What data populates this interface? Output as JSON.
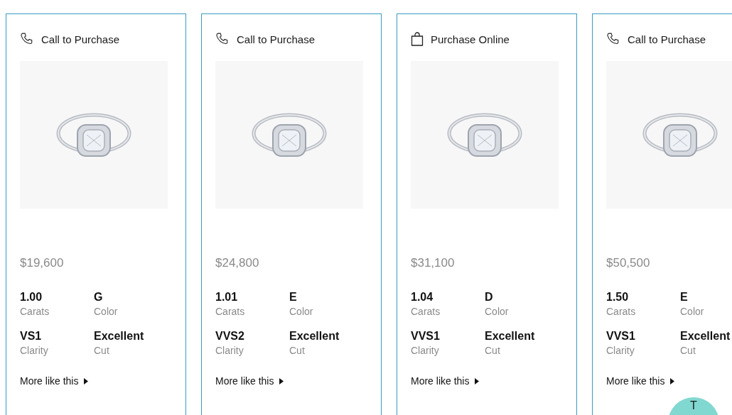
{
  "products": [
    {
      "kind": "call",
      "purchase_label": "Call to Purchase",
      "price": "$19,600",
      "specs": [
        {
          "value": "1.00",
          "label": "Carats"
        },
        {
          "value": "G",
          "label": "Color"
        },
        {
          "value": "VS1",
          "label": "Clarity"
        },
        {
          "value": "Excellent",
          "label": "Cut"
        }
      ],
      "more_link": "More like this"
    },
    {
      "kind": "call",
      "purchase_label": "Call to Purchase",
      "price": "$24,800",
      "specs": [
        {
          "value": "1.01",
          "label": "Carats"
        },
        {
          "value": "E",
          "label": "Color"
        },
        {
          "value": "VVS2",
          "label": "Clarity"
        },
        {
          "value": "Excellent",
          "label": "Cut"
        }
      ],
      "more_link": "More like this"
    },
    {
      "kind": "online",
      "purchase_label": "Purchase Online",
      "price": "$31,100",
      "specs": [
        {
          "value": "1.04",
          "label": "Carats"
        },
        {
          "value": "D",
          "label": "Color"
        },
        {
          "value": "VVS1",
          "label": "Clarity"
        },
        {
          "value": "Excellent",
          "label": "Cut"
        }
      ],
      "more_link": "More like this"
    },
    {
      "kind": "call",
      "purchase_label": "Call to Purchase",
      "price": "$50,500",
      "specs": [
        {
          "value": "1.50",
          "label": "Carats"
        },
        {
          "value": "E",
          "label": "Color"
        },
        {
          "value": "VVS1",
          "label": "Clarity"
        },
        {
          "value": "Excellent",
          "label": "Cut"
        }
      ],
      "more_link": "More like this"
    }
  ],
  "chat_button": {
    "label": "T"
  }
}
